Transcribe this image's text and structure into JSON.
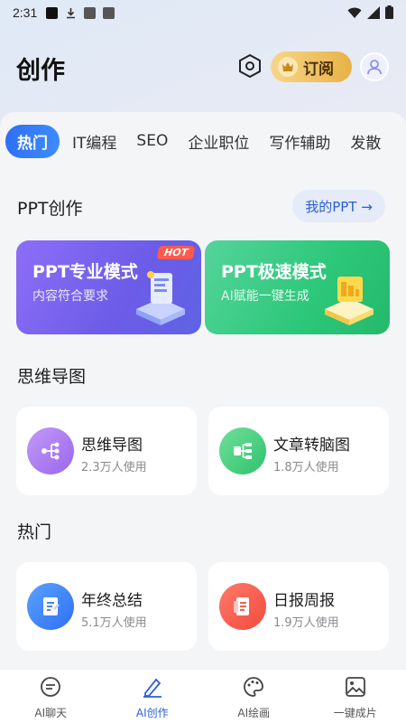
{
  "status": {
    "time": "2:31"
  },
  "header": {
    "title": "创作",
    "subscribe_label": "订阅"
  },
  "tabs": [
    "热门",
    "IT编程",
    "SEO",
    "企业职位",
    "写作辅助",
    "发散"
  ],
  "ppt": {
    "section_title": "PPT创作",
    "my_ppt_label": "我的PPT →",
    "cards": [
      {
        "title": "PPT专业模式",
        "subtitle": "内容符合要求",
        "badge": "HOT"
      },
      {
        "title": "PPT极速模式",
        "subtitle": "AI赋能一键生成"
      }
    ]
  },
  "mindmap": {
    "section_title": "思维导图",
    "items": [
      {
        "title": "思维导图",
        "usage": "2.3万人使用",
        "icon": "mindmap-icon"
      },
      {
        "title": "文章转脑图",
        "usage": "1.8万人使用",
        "icon": "article-mindmap-icon"
      }
    ]
  },
  "hot": {
    "section_title": "热门",
    "items": [
      {
        "title": "年终总结",
        "usage": "5.1万人使用",
        "icon": "document-edit-icon"
      },
      {
        "title": "日报周报",
        "usage": "1.9万人使用",
        "icon": "report-icon"
      }
    ]
  },
  "bottom_nav": [
    {
      "label": "AI聊天",
      "icon": "chat-icon"
    },
    {
      "label": "AI创作",
      "icon": "pen-icon",
      "active": true
    },
    {
      "label": "AI绘画",
      "icon": "palette-icon"
    },
    {
      "label": "一键成片",
      "icon": "image-icon"
    }
  ],
  "colors": {
    "accent": "#2e6ff5",
    "gold": "#e7b245",
    "purple": "#6c5ce7",
    "green": "#2cc779",
    "red": "#f24a3c"
  }
}
